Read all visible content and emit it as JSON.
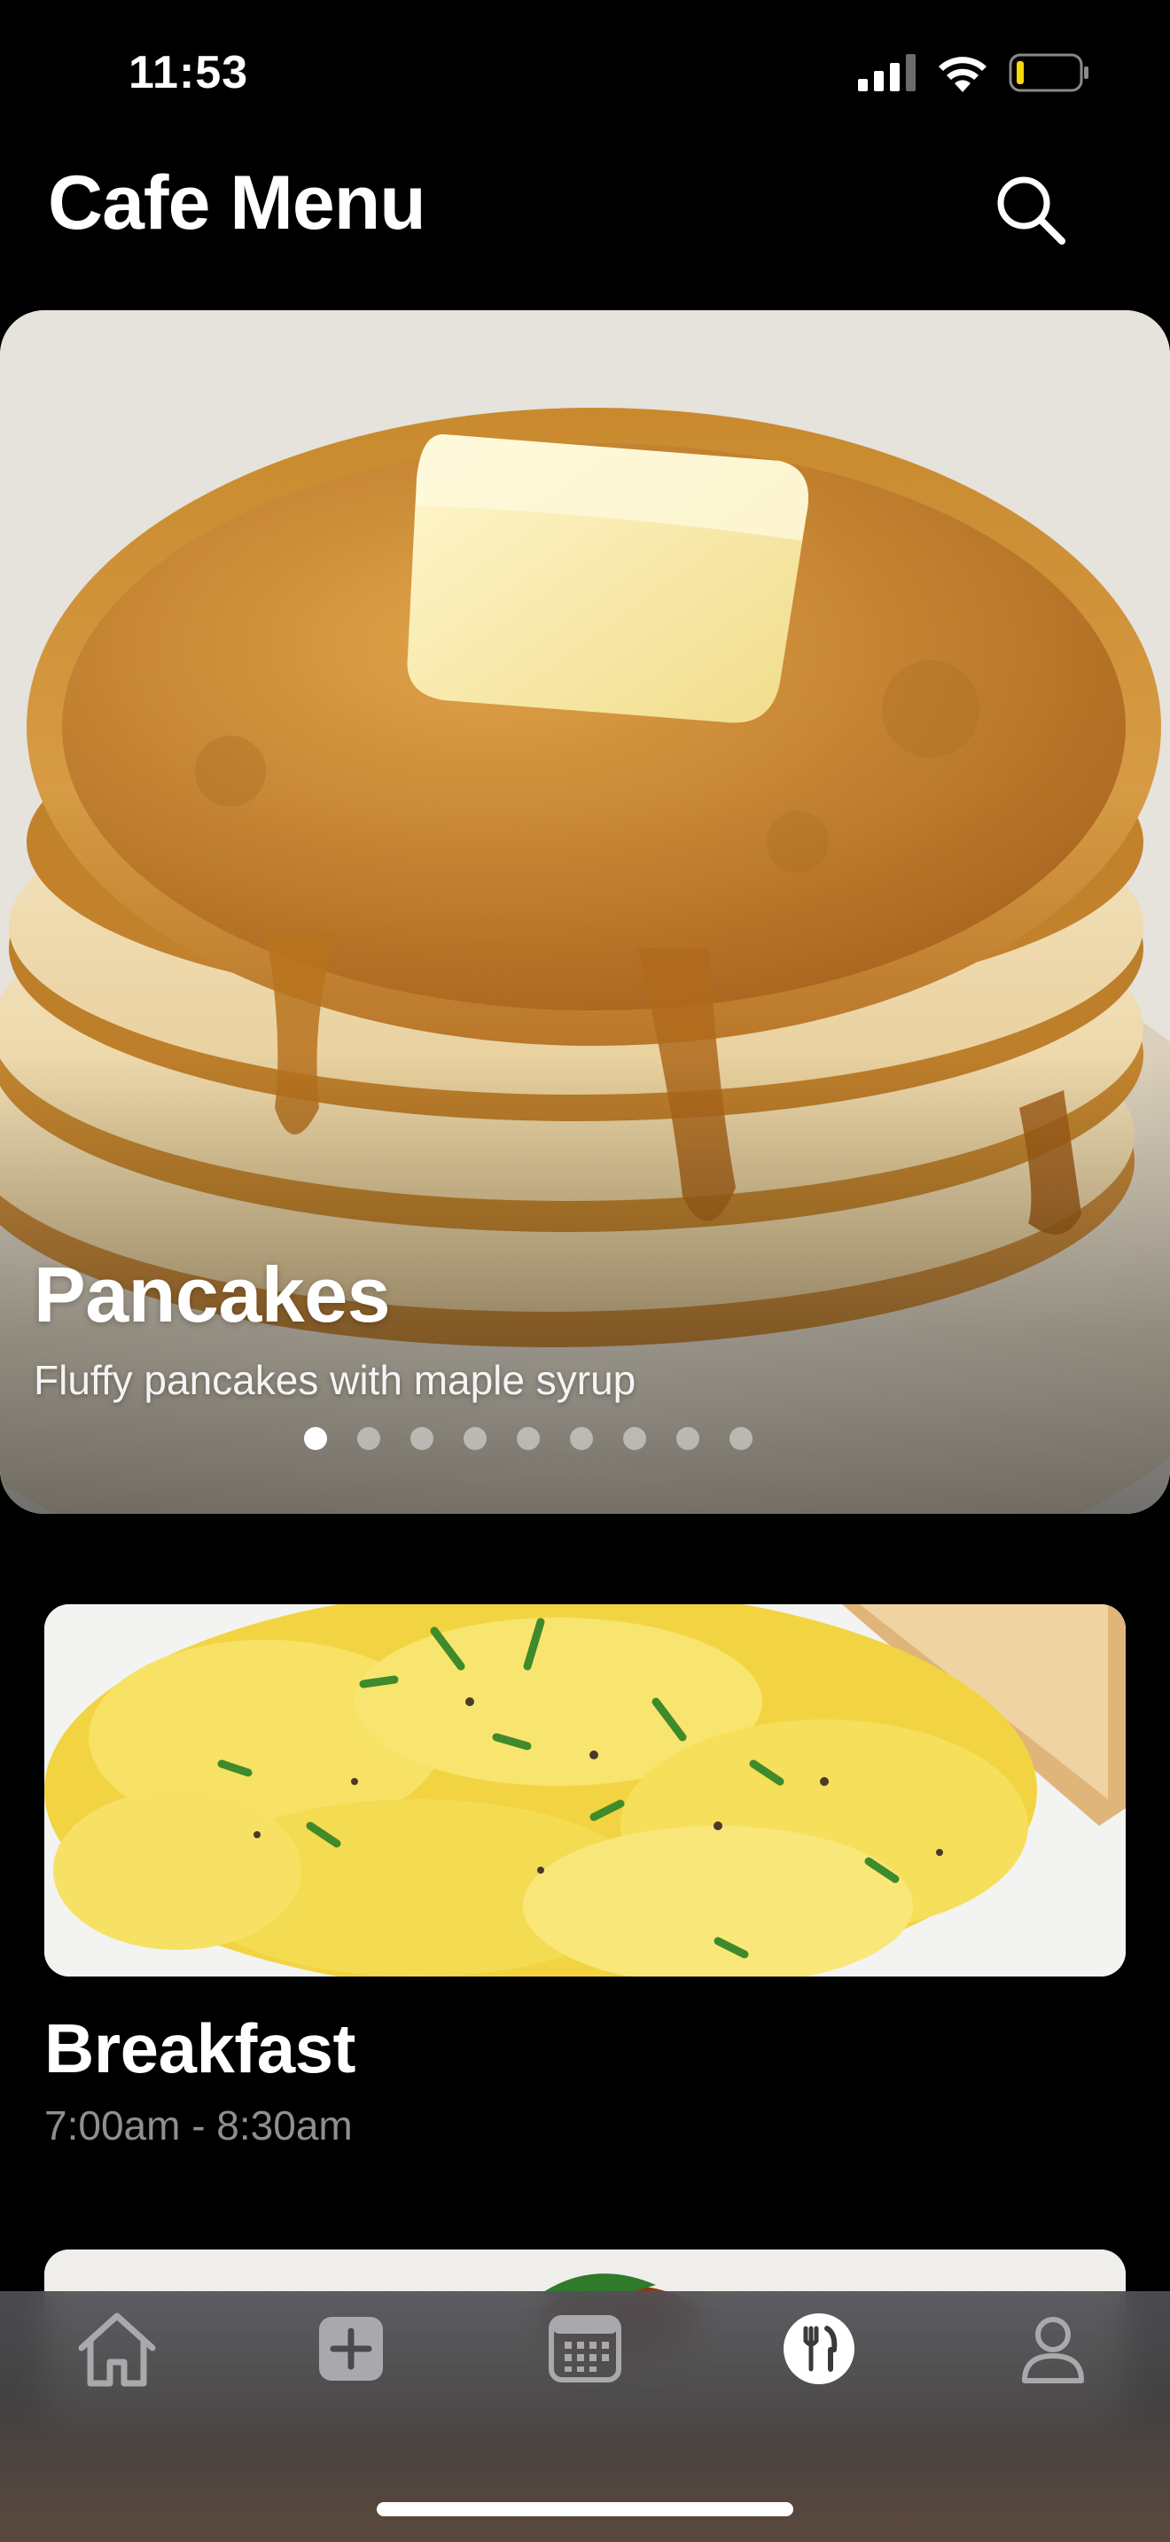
{
  "status_bar": {
    "time": "11:53",
    "icons": [
      "cellular-signal-icon",
      "wifi-icon",
      "battery-icon"
    ],
    "battery_color": "#f5d90a"
  },
  "header": {
    "title": "Cafe Menu",
    "search_icon": "search-icon"
  },
  "hero": {
    "title": "Pancakes",
    "subtitle": "Fluffy pancakes with maple syrup",
    "page_count": 9,
    "active_page": 1
  },
  "meals": [
    {
      "title": "Breakfast",
      "time": "7:00am - 8:30am"
    }
  ],
  "tab_bar": {
    "tabs": [
      {
        "icon": "home-icon",
        "selected": false
      },
      {
        "icon": "add-icon",
        "selected": false
      },
      {
        "icon": "calendar-icon",
        "selected": false
      },
      {
        "icon": "fork-knife-icon",
        "selected": true
      },
      {
        "icon": "person-icon",
        "selected": false
      }
    ]
  },
  "colors": {
    "background": "#000000",
    "secondary_text": "#8e8e93",
    "tab_inactive": "#a9a9ad",
    "tab_active": "#ffffff"
  }
}
